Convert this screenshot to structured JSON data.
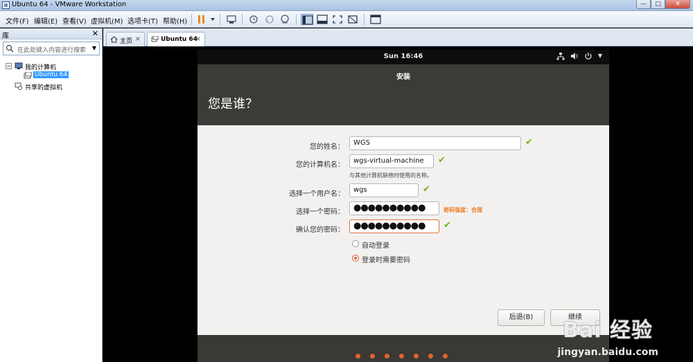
{
  "window": {
    "title": "Ubuntu 64 - VMware Workstation",
    "min": "—",
    "max": "□",
    "close": "✕"
  },
  "menu": [
    "文件(F)",
    "编辑(E)",
    "查看(V)",
    "虚拟机(M)",
    "选项卡(T)",
    "帮助(H)"
  ],
  "library": {
    "title": "库",
    "close": "✕",
    "search_placeholder": "在此处键入内容进行搜索",
    "tree": {
      "my_computer": "我的计算机",
      "vm": "Ubuntu 64",
      "shared": "共享的虚拟机"
    }
  },
  "tabs": [
    {
      "label": "主页"
    },
    {
      "label": "Ubuntu 64"
    }
  ],
  "guest": {
    "clock": "Sun 16:46",
    "window_title": "安装",
    "page_title": "您是谁？",
    "fields": {
      "name_label": "您的姓名：",
      "name_value": "WGS",
      "host_label": "您的计算机名：",
      "host_value": "wgs-virtual-machine",
      "host_hint": "与其他计算机联络时使用的名称。",
      "user_label": "选择一个用户名：",
      "user_value": "wgs",
      "pass_label": "选择一个密码：",
      "pass_value": "●●●●●●●●●●",
      "strength": "密码强度：合理",
      "confirm_label": "确认您的密码：",
      "confirm_value": "●●●●●●●●●●"
    },
    "login": {
      "auto": "自动登录",
      "require": "登录时需要密码",
      "selected": "require"
    },
    "buttons": {
      "back": "后退(B)",
      "continue": "继续"
    },
    "progress_steps": 7
  },
  "watermark": {
    "brand": "Bai 经验",
    "url": "jingyan.baidu.com"
  },
  "colors": {
    "accent": "#e2642f",
    "check": "#73b122",
    "strength": "#f07b1f"
  }
}
